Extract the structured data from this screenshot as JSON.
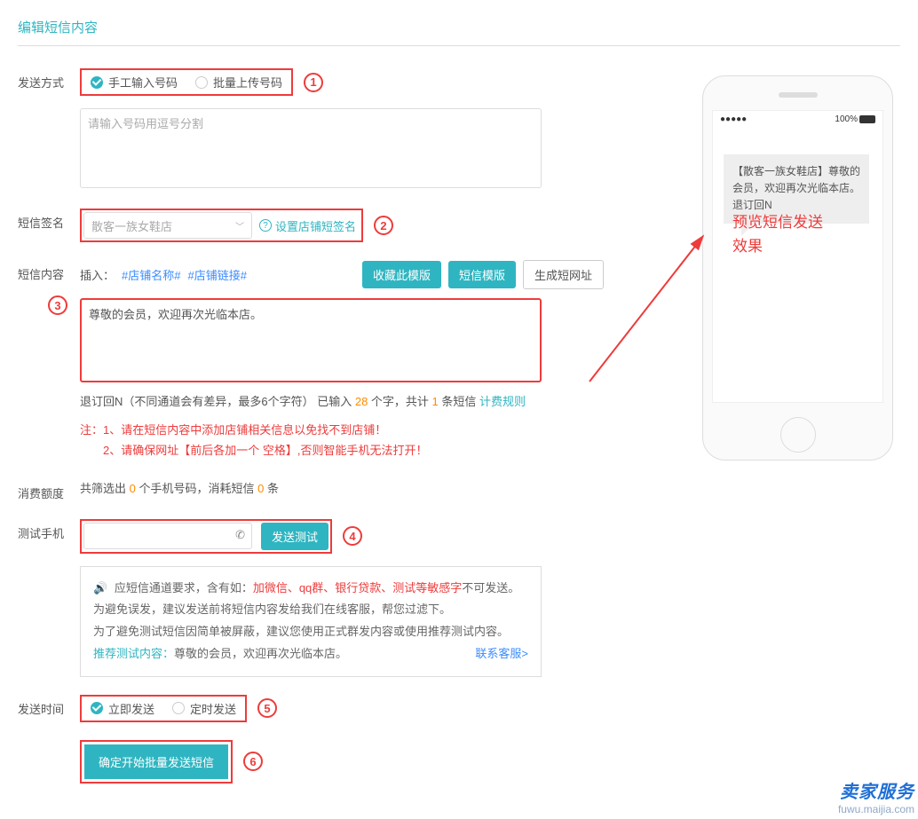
{
  "title": "编辑短信内容",
  "sendMethod": {
    "label": "发送方式",
    "marker": "1",
    "options": [
      {
        "label": "手工输入号码",
        "checked": true
      },
      {
        "label": "批量上传号码",
        "checked": false
      }
    ],
    "numbersPlaceholder": "请输入号码用逗号分割"
  },
  "signature": {
    "label": "短信签名",
    "marker": "2",
    "selected": "散客一族女鞋店",
    "setLink": "设置店铺短签名"
  },
  "content": {
    "label": "短信内容",
    "marker": "3",
    "insertPrefix": "插入：",
    "tagShopName": "#店铺名称#",
    "tagShopLink": "#店铺链接#",
    "btnFav": "收藏此模版",
    "btnTpl": "短信模版",
    "btnShortUrl": "生成短网址",
    "text": "尊敬的会员，欢迎再次光临本店。",
    "counter": {
      "prefix": "退订回N（不同通道会有差异，最多6个字符）  已输入 ",
      "chars": "28",
      "mid": " 个字，共计 ",
      "msgs": "1",
      "tail": " 条短信 ",
      "ruleLink": "计费规则"
    },
    "note1": "注：1、请在短信内容中添加店铺相关信息以免找不到店铺！",
    "note2": "　　2、请确保网址【前后各加一个 空格】,否则智能手机无法打开！"
  },
  "quota": {
    "label": "消费额度",
    "p1": "共筛选出 ",
    "n1": "0",
    "p2": " 个手机号码，消耗短信 ",
    "n2": "0",
    "p3": " 条"
  },
  "test": {
    "label": "测试手机",
    "marker": "4",
    "btn": "发送测试",
    "tips": {
      "line1a": "应短信通道要求，含有如：",
      "line1b": "加微信、qq群、银行贷款、测试等敏感字",
      "line1c": "不可发送。为避免误发，建议发送前将短信内容发给我们在线客服，帮您过滤下。",
      "line2": "为了避免测试短信因简单被屏蔽，建议您使用正式群发内容或使用推荐测试内容。",
      "recLabel": "推荐测试内容：",
      "recText": "尊敬的会员，欢迎再次光临本店。",
      "contact": "联系客服>"
    }
  },
  "sendTime": {
    "label": "发送时间",
    "marker": "5",
    "options": [
      {
        "label": "立即发送",
        "checked": true
      },
      {
        "label": "定时发送",
        "checked": false
      }
    ]
  },
  "submit": {
    "marker": "6",
    "label": "确定开始批量发送短信"
  },
  "preview": {
    "carrier": "●●●●●",
    "battery": "100%",
    "sms": "【散客一族女鞋店】尊敬的会员，欢迎再次光临本店。退订回N",
    "overlay": "预览短信发送\n效果"
  },
  "watermark": {
    "top": "卖家服务",
    "bottom": "fuwu.maijia.com"
  }
}
